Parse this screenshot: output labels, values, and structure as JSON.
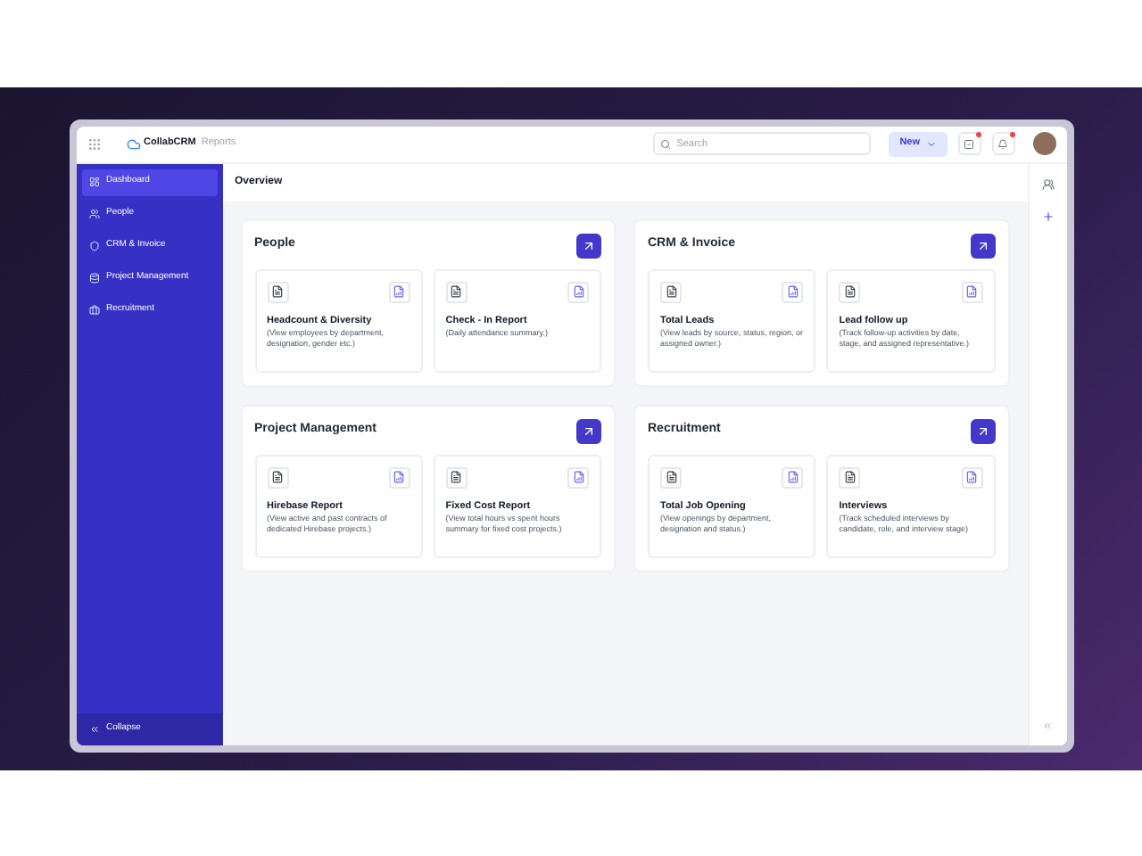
{
  "app": {
    "brand": "CollabCRM",
    "section": "Reports"
  },
  "search": {
    "placeholder": "Search"
  },
  "new_button": "New",
  "notifications": [
    {
      "kind": "tasks",
      "unread": true
    },
    {
      "kind": "bell",
      "unread": true
    }
  ],
  "sidebar": {
    "items": [
      {
        "label": "Dashboard",
        "selected": true
      },
      {
        "label": "People",
        "selected": false
      },
      {
        "label": "CRM & Invoice",
        "selected": false
      },
      {
        "label": "Project Management",
        "selected": false
      },
      {
        "label": "Recruitment",
        "selected": false
      }
    ],
    "collapse": "Collapse"
  },
  "page_title": "Overview",
  "sections": [
    {
      "title": "People",
      "reports": [
        {
          "title": "Headcount & Diversity",
          "description": "(View employees by department, designation, gender etc.)"
        },
        {
          "title": "Check - In Report",
          "description": "(Daily attendance summary.)"
        }
      ]
    },
    {
      "title": "CRM & Invoice",
      "reports": [
        {
          "title": "Total Leads",
          "description": "(View leads by source, status, region, or assigned owner.)"
        },
        {
          "title": "Lead follow up",
          "description": "(Track follow-up activities by date, stage, and assigned representative.)"
        }
      ]
    },
    {
      "title": "Project Management",
      "reports": [
        {
          "title": "Hirebase Report",
          "description": "(View active and past contracts of dedicated Hirebase projects.)"
        },
        {
          "title": "Fixed Cost Report",
          "description": "(View total hours vs spent hours summary for fixed cost projects.)"
        }
      ]
    },
    {
      "title": "Recruitment",
      "reports": [
        {
          "title": "Total Job Opening",
          "description": "(View openings by department, designation and status.)"
        },
        {
          "title": "Interviews",
          "description": "(Track scheduled interviews by candidate, role, and interview stage)"
        }
      ]
    }
  ]
}
